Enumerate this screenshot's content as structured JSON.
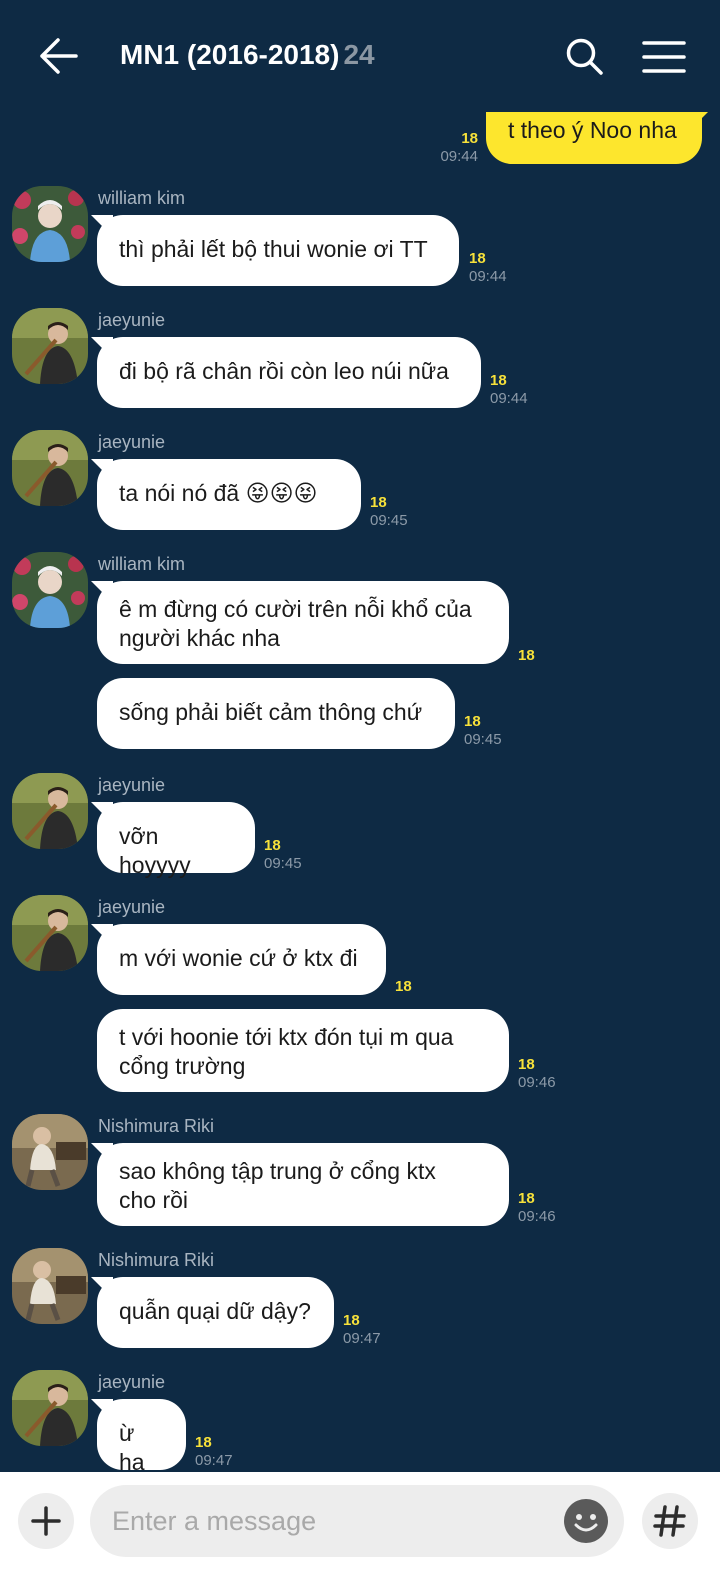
{
  "header": {
    "title": "MN1 (2016-2018)",
    "member_count": "24"
  },
  "messages": [
    {
      "sender": "me",
      "text": "t theo ý Noo nha",
      "unread": "18",
      "time": "09:44"
    },
    {
      "sender": "william kim",
      "text": "thì phải lết bộ thui wonie ơi TT",
      "unread": "18",
      "time": "09:44"
    },
    {
      "sender": "jaeyunie",
      "text": "đi bộ rã chân rồi còn leo núi nữa",
      "unread": "18",
      "time": "09:44"
    },
    {
      "sender": "jaeyunie",
      "text": "ta nói nó đã 😝😝😝",
      "unread": "18",
      "time": "09:45"
    },
    {
      "sender": "william kim",
      "text": "ê m đừng có cười trên nỗi khổ của\nngười khác nha",
      "unread": "18",
      "time": ""
    },
    {
      "sender": "william kim",
      "text": "sống phải biết cảm thông chứ",
      "unread": "18",
      "time": "09:45"
    },
    {
      "sender": "jaeyunie",
      "text": "vỡn hoyyyy",
      "unread": "18",
      "time": "09:45"
    },
    {
      "sender": "jaeyunie",
      "text": "m với wonie cứ ở ktx đi",
      "unread": "18",
      "time": ""
    },
    {
      "sender": "jaeyunie",
      "text": "t với hoonie tới ktx đón tụi m qua\ncổng trường",
      "unread": "18",
      "time": "09:46"
    },
    {
      "sender": "Nishimura Riki",
      "text": "sao không tập trung ở cổng ktx\ncho rồi",
      "unread": "18",
      "time": "09:46"
    },
    {
      "sender": "Nishimura Riki",
      "text": "quẫn quại dữ dậy?",
      "unread": "18",
      "time": "09:47"
    },
    {
      "sender": "jaeyunie",
      "text": "ừ ha",
      "unread": "18",
      "time": "09:47"
    }
  ],
  "input": {
    "placeholder": "Enter a message"
  },
  "icons": {
    "back": "arrow-left-icon",
    "search": "search-icon",
    "menu": "hamburger-menu-icon",
    "attach": "plus-icon",
    "emoji": "emoji-icon",
    "hashtag": "hashtag-icon"
  },
  "colors": {
    "background": "#0e2a44",
    "my_bubble": "#fde62d",
    "other_bubble": "#ffffff",
    "unread_count": "#f7e13a",
    "timestamp": "#8c9aa8",
    "sender_name": "#a9b5c1"
  }
}
